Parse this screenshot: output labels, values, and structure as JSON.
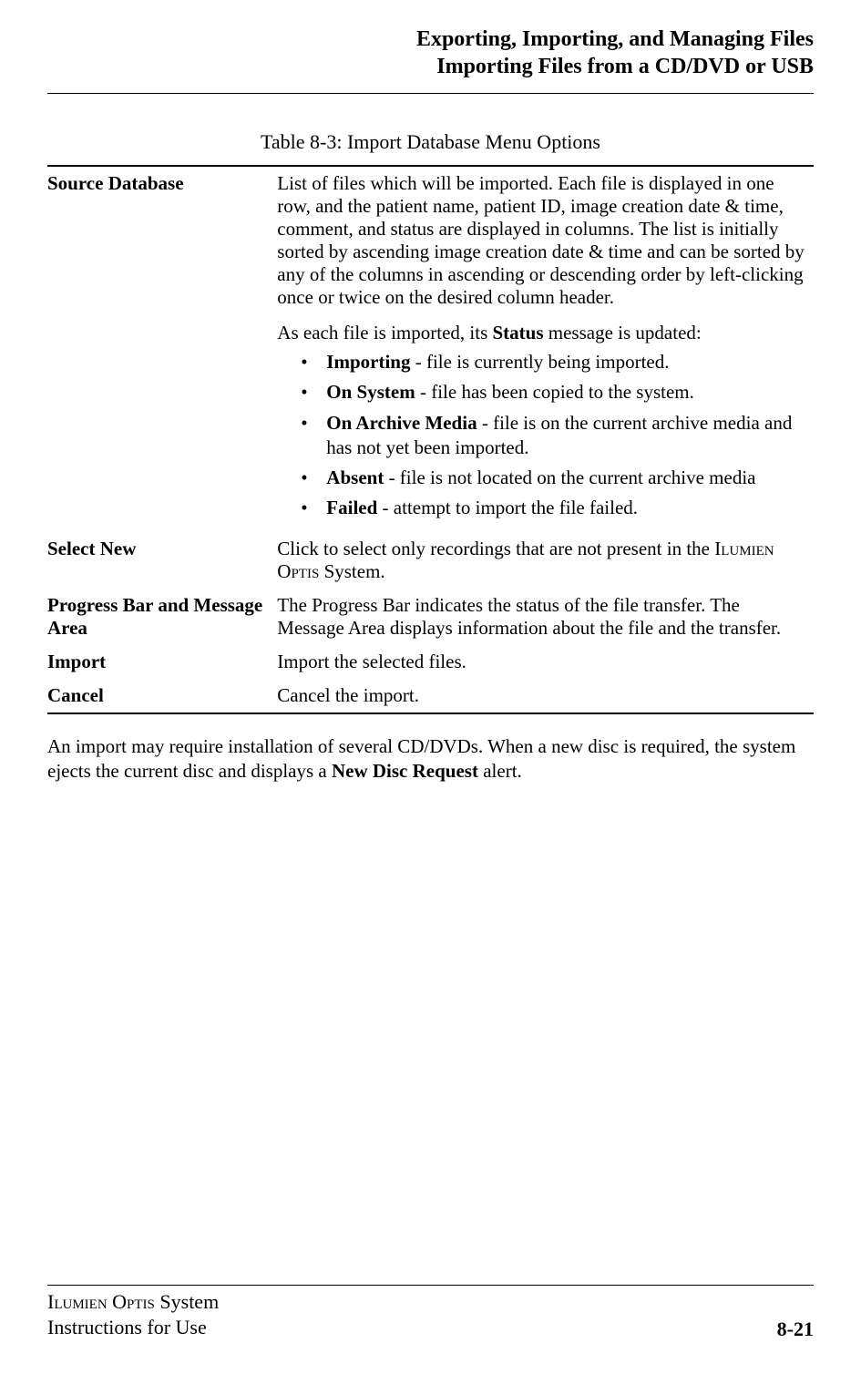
{
  "header": {
    "line1": "Exporting, Importing, and Managing Files",
    "line2": "Importing Files from a CD/DVD or USB"
  },
  "table": {
    "caption": "Table 8-3:  Import Database Menu Options",
    "rows": {
      "source_database": {
        "term": "Source Database",
        "desc": "List of files which will be imported. Each file is displayed in one row, and the patient name, patient ID, image creation date & time, comment, and status are displayed in columns. The list is initially sorted by ascending image creation date & time and can be sorted by any of the columns in ascending or descending order by left-clicking once or twice on the desired column header.",
        "status_lead_pre": "As each file is imported, its ",
        "status_label": "Status",
        "status_lead_post": " message is updated:",
        "statuses": {
          "importing": {
            "label": "Importing",
            "text": " - file is currently being imported."
          },
          "on_system": {
            "label": "On System",
            "text": " - file has been copied to the system."
          },
          "on_archive": {
            "label": "On Archive Media",
            "text": " - file is on the current archive media and has not yet been imported."
          },
          "absent": {
            "label": "Absent",
            "text": " - file is not located on the current archive media"
          },
          "failed": {
            "label": "Failed",
            "text": " - attempt to import the file failed."
          }
        }
      },
      "select_new": {
        "term": "Select New",
        "desc_pre": "Click to select only recordings that are not present in the ",
        "system1": "Ilumien",
        "system2": "Optis",
        "desc_post": " System."
      },
      "progress": {
        "term": "Progress Bar and Message Area",
        "desc": "The Progress Bar indicates the status of the file transfer. The Message Area displays information about the file and the transfer."
      },
      "import": {
        "term": "Import",
        "desc": "Import the selected files."
      },
      "cancel": {
        "term": "Cancel",
        "desc": "Cancel the import."
      }
    }
  },
  "body": {
    "para_pre": "An import may require installation of several CD/DVDs. When a new disc is required, the system ejects the current disc and displays a ",
    "alert_name": "New Disc Request",
    "para_post": " alert."
  },
  "footer": {
    "system1": "Ilumien",
    "system2": "Optis",
    "system_word": " System",
    "line2": "Instructions for Use",
    "page": "8-21"
  }
}
